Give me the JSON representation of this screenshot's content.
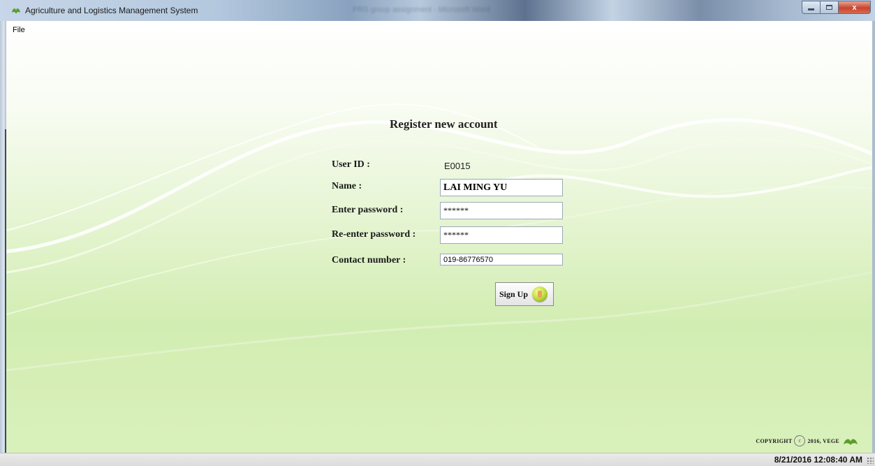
{
  "window": {
    "title": "Agriculture and Logistics Management System",
    "background_window_title": "PRS group assignment - Microsoft Word",
    "close_glyph": "x"
  },
  "menu": {
    "items": [
      {
        "label": "File"
      }
    ]
  },
  "form": {
    "title": "Register new account",
    "user_id_label": "User ID :",
    "user_id_value": "E0015",
    "name_label": "Name :",
    "name_value": "LAI MING YU",
    "password_label": "Enter password :",
    "password_value": "******",
    "reenter_label": "Re-enter password :",
    "reenter_value": "******",
    "contact_label": "Contact number :",
    "contact_value": "019-86776570",
    "signup_label": "Sign Up"
  },
  "footer": {
    "copyright_left": "COPYRIGHT",
    "copyright_symbol": "c",
    "copyright_right": "2016, VEGE"
  },
  "statusbar": {
    "datetime": "8/21/2016 12:08:40 AM"
  },
  "colors": {
    "accent_green": "#7bb32e",
    "leaf_green": "#5a9e2a"
  },
  "icons": [
    "leaf-icon",
    "minimize-icon",
    "maximize-icon",
    "close-icon",
    "upload-orb-icon",
    "copyright-icon",
    "leaf-logo-icon",
    "resize-grip-icon"
  ]
}
